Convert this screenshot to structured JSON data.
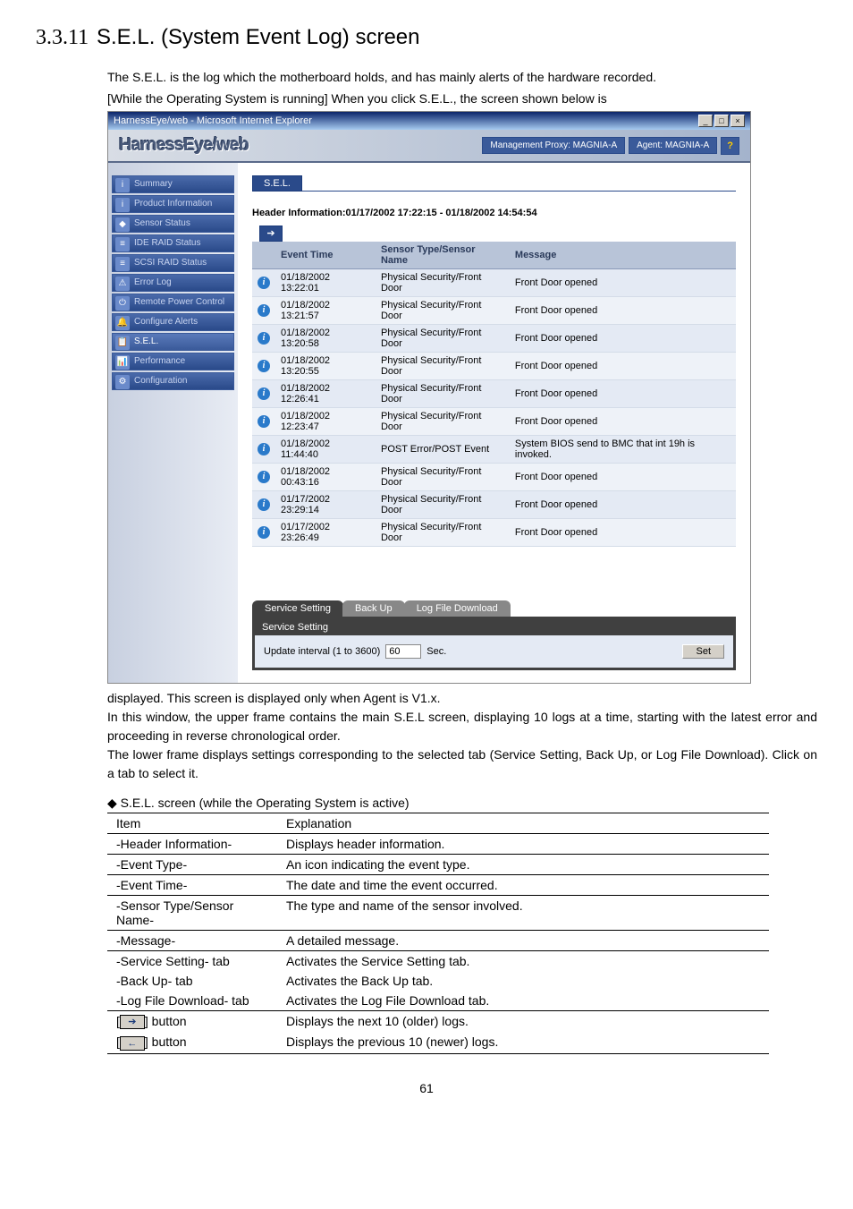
{
  "section": {
    "number": "3.3.11",
    "title": "S.E.L. (System Event Log) screen"
  },
  "intro": {
    "p1": "The S.E.L. is the log which the motherboard holds, and has mainly alerts of the hardware recorded.",
    "p2": "[While the Operating System is running] When you click S.E.L., the screen shown below is"
  },
  "screenshot": {
    "window_title": "HarnessEye/web - Microsoft Internet Explorer",
    "product_name": "HarnessEye/web",
    "proxy_label": "Management Proxy: MAGNIA-A",
    "agent_label": "Agent: MAGNIA-A",
    "nav": [
      "Summary",
      "Product Information",
      "Sensor Status",
      "IDE RAID Status",
      "SCSI RAID Status",
      "Error Log",
      "Remote Power Control",
      "Configure Alerts",
      "S.E.L.",
      "Performance",
      "Configuration"
    ],
    "panel_label": "S.E.L.",
    "header_info": "Header Information:01/17/2002 17:22:15 - 01/18/2002 14:54:54",
    "columns": {
      "time": "Event Time",
      "sensor": "Sensor Type/Sensor Name",
      "msg": "Message"
    },
    "rows": [
      {
        "time": "01/18/2002 13:22:01",
        "sensor": "Physical Security/Front Door",
        "msg": "Front Door opened"
      },
      {
        "time": "01/18/2002 13:21:57",
        "sensor": "Physical Security/Front Door",
        "msg": "Front Door opened"
      },
      {
        "time": "01/18/2002 13:20:58",
        "sensor": "Physical Security/Front Door",
        "msg": "Front Door opened"
      },
      {
        "time": "01/18/2002 13:20:55",
        "sensor": "Physical Security/Front Door",
        "msg": "Front Door opened"
      },
      {
        "time": "01/18/2002 12:26:41",
        "sensor": "Physical Security/Front Door",
        "msg": "Front Door opened"
      },
      {
        "time": "01/18/2002 12:23:47",
        "sensor": "Physical Security/Front Door",
        "msg": "Front Door opened"
      },
      {
        "time": "01/18/2002 11:44:40",
        "sensor": "POST Error/POST Event",
        "msg": "System BIOS send to BMC that int 19h is invoked."
      },
      {
        "time": "01/18/2002 00:43:16",
        "sensor": "Physical Security/Front Door",
        "msg": "Front Door opened"
      },
      {
        "time": "01/17/2002 23:29:14",
        "sensor": "Physical Security/Front Door",
        "msg": "Front Door opened"
      },
      {
        "time": "01/17/2002 23:26:49",
        "sensor": "Physical Security/Front Door",
        "msg": "Front Door opened"
      }
    ],
    "tabs": {
      "service": "Service Setting",
      "backup": "Back Up",
      "logdl": "Log File Download"
    },
    "subpanel_label": "Service Setting",
    "interval_label": "Update interval (1 to 3600)",
    "interval_value": "60",
    "interval_unit": "Sec.",
    "set_btn": "Set"
  },
  "post_screenshot": {
    "p1": "displayed. This screen is displayed only when Agent is V1.x.",
    "p2": "In this window, the upper frame contains the main S.E.L screen, displaying 10 logs at a time, starting with the latest error and proceeding in reverse chronological order.",
    "p3": "The lower frame displays settings corresponding to the selected tab (Service Setting, Back Up, or Log File Download).   Click on a tab to select it."
  },
  "table_heading": "◆ S.E.L. screen (while the Operating System is active)",
  "desc_table": {
    "col1": "Item",
    "col2": "Explanation",
    "rows": [
      {
        "item": "-Header Information-",
        "exp": "Displays header information.",
        "sep": false
      },
      {
        "item": "-Event Type-",
        "exp": "An icon indicating the event type.",
        "sep": true
      },
      {
        "item": "-Event Time-",
        "exp": "The date and time the event occurred.",
        "sep": true
      },
      {
        "item": "-Sensor Type/Sensor Name-",
        "exp": "The type and name of the sensor involved.",
        "sep": true
      },
      {
        "item": "-Message-",
        "exp": "A detailed message.",
        "sep": true
      },
      {
        "item": "-Service Setting- tab",
        "exp": "Activates the Service Setting tab.",
        "sep": true
      },
      {
        "item": "-Back Up- tab",
        "exp": "Activates the Back Up tab.",
        "sep": false
      },
      {
        "item": "-Log File Download- tab",
        "exp": "Activates the Log File Download tab.",
        "sep": false
      },
      {
        "item_btn": "➔",
        "item_suffix": " button",
        "exp": "Displays the next 10 (older) logs.",
        "sep": true
      },
      {
        "item_btn": "←",
        "item_suffix": " button",
        "exp": "Displays the previous 10 (newer) logs.",
        "sep": false
      }
    ]
  },
  "page_num": "61"
}
